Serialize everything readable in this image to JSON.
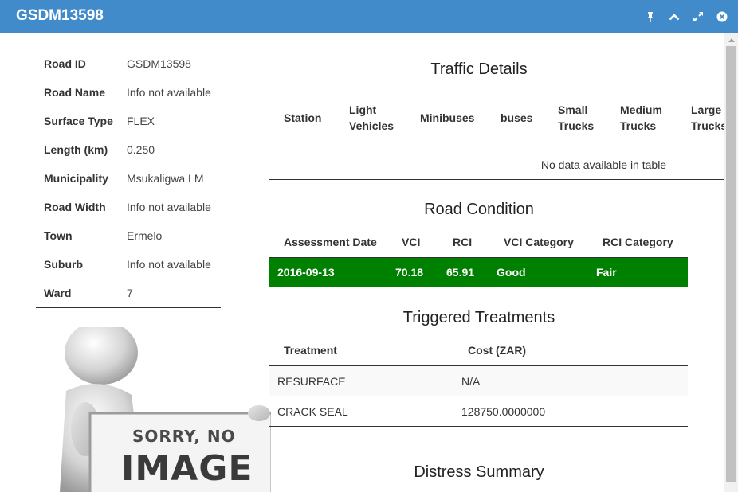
{
  "window": {
    "title": "GSDM13598"
  },
  "info": [
    {
      "key": "Road ID",
      "value": "GSDM13598"
    },
    {
      "key": "Road Name",
      "value": "Info not available"
    },
    {
      "key": "Surface Type",
      "value": "FLEX"
    },
    {
      "key": "Length (km)",
      "value": "0.250"
    },
    {
      "key": "Municipality",
      "value": "Msukaligwa LM"
    },
    {
      "key": "Road Width",
      "value": "Info not available"
    },
    {
      "key": "Town",
      "value": "Ermelo"
    },
    {
      "key": "Suburb",
      "value": "Info not available"
    },
    {
      "key": "Ward",
      "value": "7"
    }
  ],
  "no_image": {
    "line1": "SORRY, NO",
    "line2": "IMAGE"
  },
  "traffic": {
    "title": "Traffic Details",
    "headers": {
      "station": "Station",
      "light1": "Light",
      "light2": "Vehicles",
      "minibuses": "Minibuses",
      "buses": "buses",
      "small1": "Small",
      "small2": "Trucks",
      "medium1": "Medium",
      "medium2": "Trucks",
      "large1": "Large",
      "large2": "Trucks"
    },
    "empty": "No data available in table"
  },
  "condition": {
    "title": "Road Condition",
    "headers": [
      "Assessment Date",
      "VCI",
      "RCI",
      "VCI Category",
      "RCI Category"
    ],
    "row": [
      "2016-09-13",
      "70.18",
      "65.91",
      "Good",
      "Fair"
    ],
    "row_color": "#008000"
  },
  "treatments": {
    "title": "Triggered Treatments",
    "headers": [
      "Treatment",
      "Cost (ZAR)"
    ],
    "rows": [
      [
        "RESURFACE",
        "N/A"
      ],
      [
        "CRACK SEAL",
        "128750.0000000"
      ]
    ]
  },
  "distress": {
    "title": "Distress Summary"
  },
  "colors": {
    "titlebar": "#428bca"
  }
}
